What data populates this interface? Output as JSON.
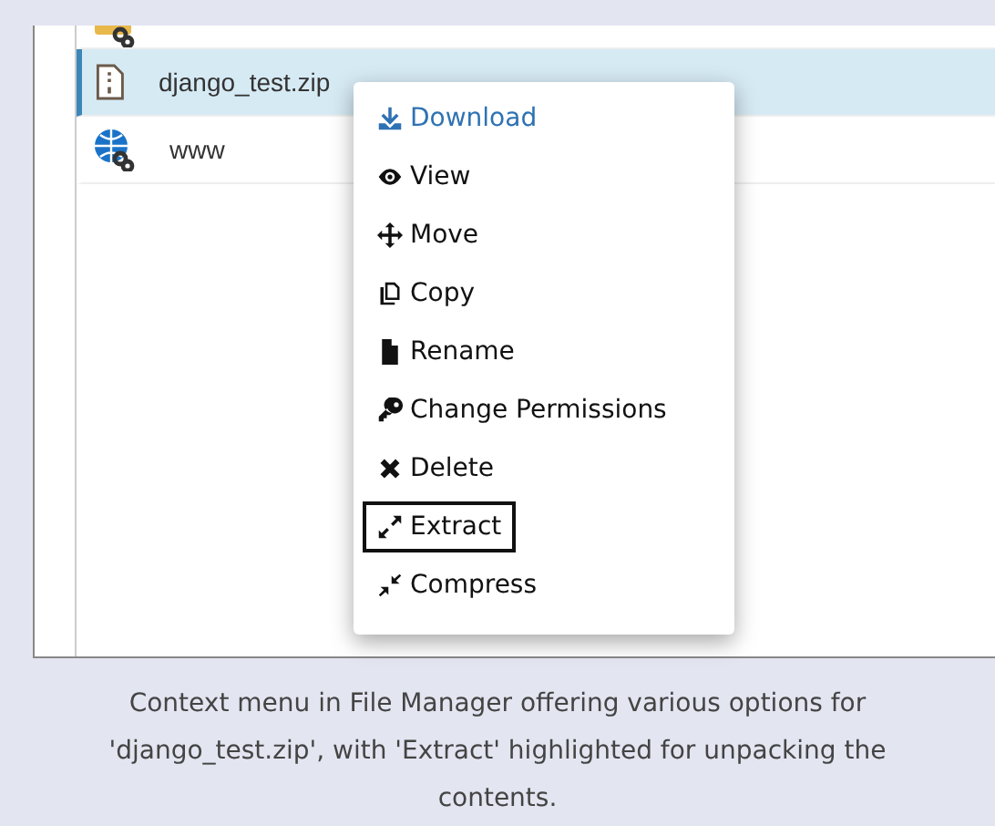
{
  "file_list": {
    "rows": [
      {
        "kind": "folder-link",
        "selected": false
      },
      {
        "kind": "zip",
        "name": "django_test.zip",
        "selected": true
      },
      {
        "kind": "web-link",
        "name": "www",
        "selected": false
      }
    ]
  },
  "context_menu": {
    "items": [
      {
        "label": "Download",
        "active": true,
        "highlighted": false
      },
      {
        "label": "View",
        "active": false,
        "highlighted": false
      },
      {
        "label": "Move",
        "active": false,
        "highlighted": false
      },
      {
        "label": "Copy",
        "active": false,
        "highlighted": false
      },
      {
        "label": "Rename",
        "active": false,
        "highlighted": false
      },
      {
        "label": "Change Permissions",
        "active": false,
        "highlighted": false
      },
      {
        "label": "Delete",
        "active": false,
        "highlighted": false
      },
      {
        "label": "Extract",
        "active": false,
        "highlighted": true
      },
      {
        "label": "Compress",
        "active": false,
        "highlighted": false
      }
    ]
  },
  "caption": "Context menu in File Manager offering various options for 'django_test.zip', with 'Extract' highlighted for unpacking the contents."
}
